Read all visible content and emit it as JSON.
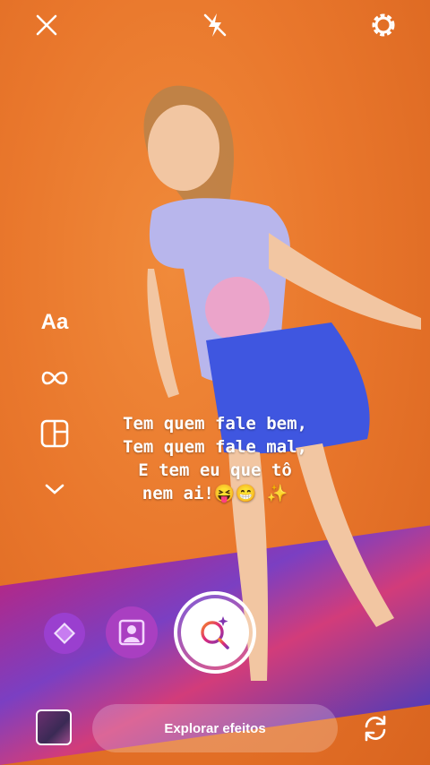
{
  "caption": {
    "line1": "Tem quem fale bem,",
    "line2": "Tem quem fale mal,",
    "line3": "E tem eu que tô",
    "line4": "nem ai!😝😁 ✨"
  },
  "top_bar": {
    "close_icon": "close-icon",
    "flash_icon": "flash-off-icon",
    "settings_icon": "gear-icon"
  },
  "left_tools": {
    "text_label": "Aa",
    "boomerang_icon": "infinity-icon",
    "layout_icon": "layout-icon",
    "more_icon": "chevron-down-icon"
  },
  "effects": [
    "gem-effect-icon",
    "portrait-effect-icon"
  ],
  "capture": {
    "icon": "search-sparkle-icon"
  },
  "bottom_bar": {
    "explore_label": "Explorar efeitos",
    "gallery_icon": "gallery-thumbnail",
    "flip_icon": "camera-flip-icon"
  },
  "colors": {
    "accent": "#e1306c",
    "background": "#e9772c",
    "purple": "#a93fc1"
  }
}
